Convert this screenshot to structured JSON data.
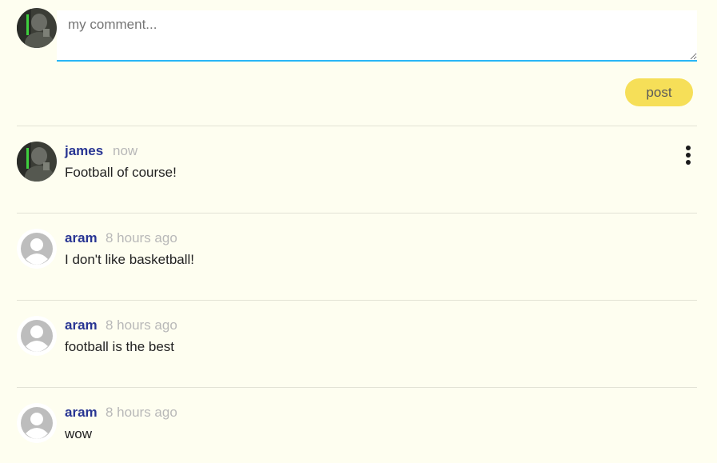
{
  "composer": {
    "placeholder": "my comment...",
    "post_label": "post",
    "avatar_icon": "user-photo-icon"
  },
  "colors": {
    "background": "#fefef0",
    "author": "#283593",
    "timestamp": "#b8b8b8",
    "post_button": "#f6df58",
    "input_underline": "#29b6f6"
  },
  "comments": [
    {
      "author": "james",
      "time": "now",
      "text": "Football of course!",
      "avatar": "user-photo-icon",
      "has_menu": true,
      "menu_icon": "more-vertical-icon"
    },
    {
      "author": "aram",
      "time": "8 hours ago",
      "text": "I don't like basketball!",
      "avatar": "default-avatar-icon"
    },
    {
      "author": "aram",
      "time": "8 hours ago",
      "text": "football is the best",
      "avatar": "default-avatar-icon"
    },
    {
      "author": "aram",
      "time": "8 hours ago",
      "text": "wow",
      "avatar": "default-avatar-icon"
    }
  ]
}
